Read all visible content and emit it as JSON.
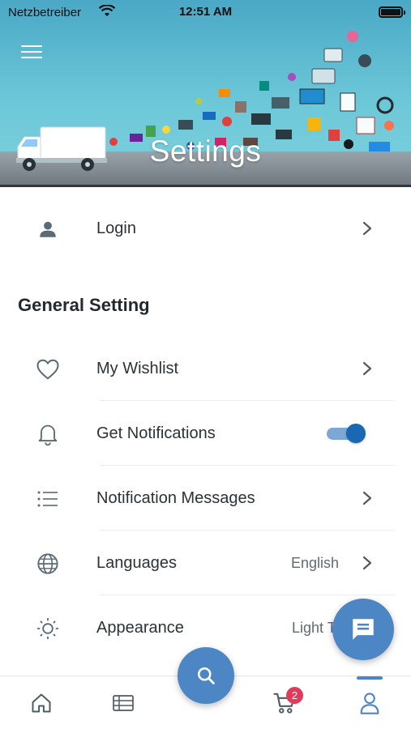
{
  "status_bar": {
    "carrier": "Netzbetreiber",
    "time": "12:51 AM",
    "wifi_icon": "wifi-icon",
    "battery_icon": "battery-icon"
  },
  "header": {
    "title": "Settings",
    "menu_icon": "hamburger-menu-icon",
    "banner_image": "delivery-truck-and-products-collage"
  },
  "login": {
    "label": "Login",
    "icon": "person-icon"
  },
  "general_setting": {
    "title": "General Setting",
    "items": [
      {
        "label": "My Wishlist",
        "icon": "heart-icon",
        "control": "chevron"
      },
      {
        "label": "Get Notifications",
        "icon": "bell-icon",
        "control": "toggle",
        "toggle_on": true
      },
      {
        "label": "Notification Messages",
        "icon": "list-icon",
        "control": "chevron"
      },
      {
        "label": "Languages",
        "icon": "globe-icon",
        "control": "chevron",
        "value": "English"
      },
      {
        "label": "Appearance",
        "icon": "sun-icon",
        "control": "chevron",
        "value": "Light T"
      }
    ]
  },
  "floating_buttons": {
    "chat_icon": "chat-icon",
    "search_icon": "search-icon"
  },
  "tab_bar": {
    "tabs": [
      {
        "name": "home",
        "icon": "home-icon"
      },
      {
        "name": "catalog",
        "icon": "catalog-icon"
      },
      {
        "name": "cart",
        "icon": "cart-icon",
        "badge": "2"
      },
      {
        "name": "account",
        "icon": "account-icon",
        "active": true
      }
    ]
  },
  "colors": {
    "accent": "#4c86c4",
    "toggle_on": "#1a67b3",
    "badge": "#e23a5a",
    "icon": "#5a6b78",
    "text": "#2b3238"
  }
}
